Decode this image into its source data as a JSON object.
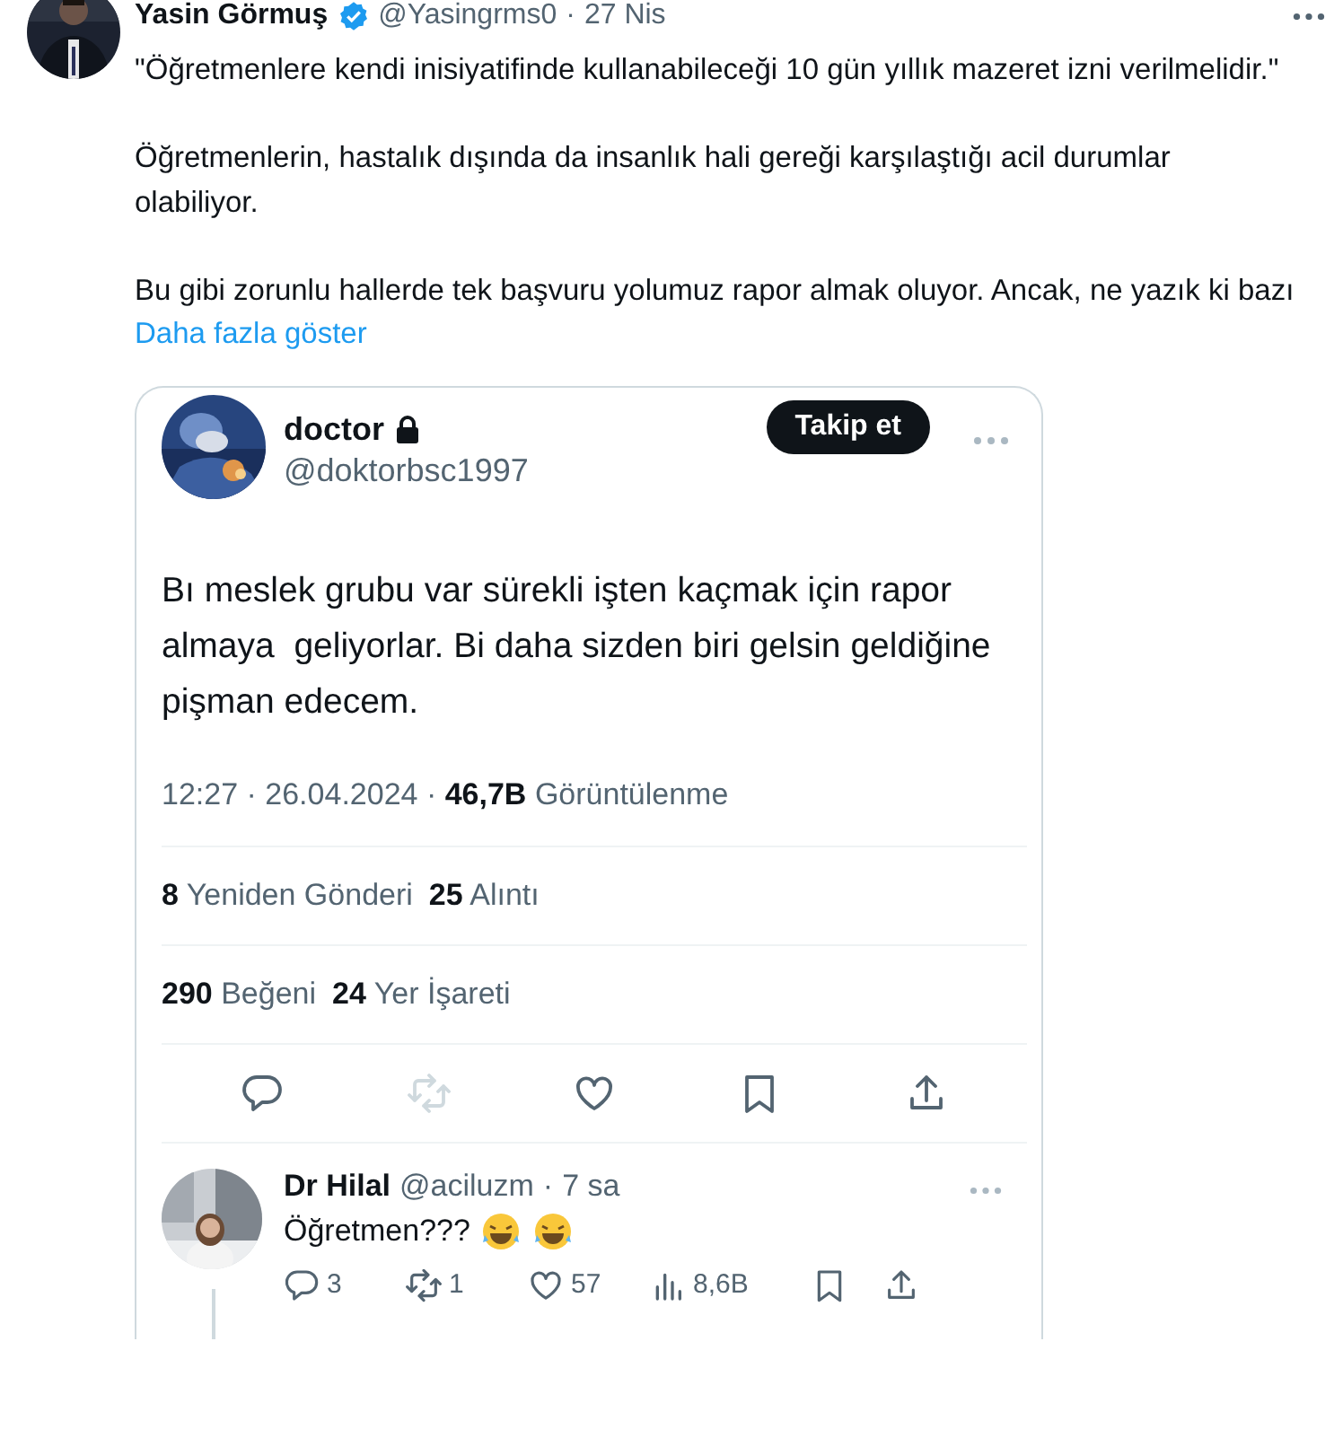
{
  "author": {
    "name": "Yasin Görmuş",
    "verified": true,
    "handle": "@Yasingrms0",
    "separator": "·",
    "time": "27 Nis"
  },
  "paragraphs": [
    "\"Öğretmenlere kendi inisiyatifinde kullanabileceği 10 gün yıllık mazeret izni verilmelidir.\"",
    "Öğretmenlerin, hastalık dışında da insanlık hali gereği karşılaştığı acil durumlar olabiliyor.",
    "Bu gibi zorunlu hallerde tek başvuru yolumuz rapor almak oluyor. Ancak, ne yazık ki bazı"
  ],
  "show_more": "Daha fazla göster",
  "embedded": {
    "author": {
      "name": "doctor",
      "locked": true,
      "handle": "@doktorbsc1997"
    },
    "follow_button": "Takip et",
    "text": "Bı meslek grubu var sürekli işten kaçmak için rapor  almaya  geliyorlar. Bi daha sizden biri gelsin geldiğine pişman edecem.",
    "meta": "12:27 · 26.04.2024 · **46,7B** Görüntülenme",
    "stat_rows": [
      [
        "**8** Yeniden Gönderi",
        "**25** Alıntı"
      ],
      [
        "**290** Beğeni",
        "**24** Yer İşareti"
      ]
    ],
    "actions": [
      {
        "kind": "reply",
        "disabled": false
      },
      {
        "kind": "repost",
        "disabled": true
      },
      {
        "kind": "like",
        "disabled": false
      },
      {
        "kind": "bookmark",
        "disabled": false
      },
      {
        "kind": "share",
        "disabled": false
      }
    ],
    "reply": {
      "name": "Dr Hilal",
      "handle": "@aciluzm",
      "separator": "·",
      "time": "7 sa",
      "text": "Öğretmen???",
      "actions": [
        {
          "kind": "reply",
          "count": "3"
        },
        {
          "kind": "repost",
          "count": "1"
        },
        {
          "kind": "like",
          "count": "57"
        },
        {
          "kind": "views",
          "count": "8,6B"
        },
        {
          "kind": "bookmark"
        },
        {
          "kind": "share"
        }
      ]
    }
  }
}
